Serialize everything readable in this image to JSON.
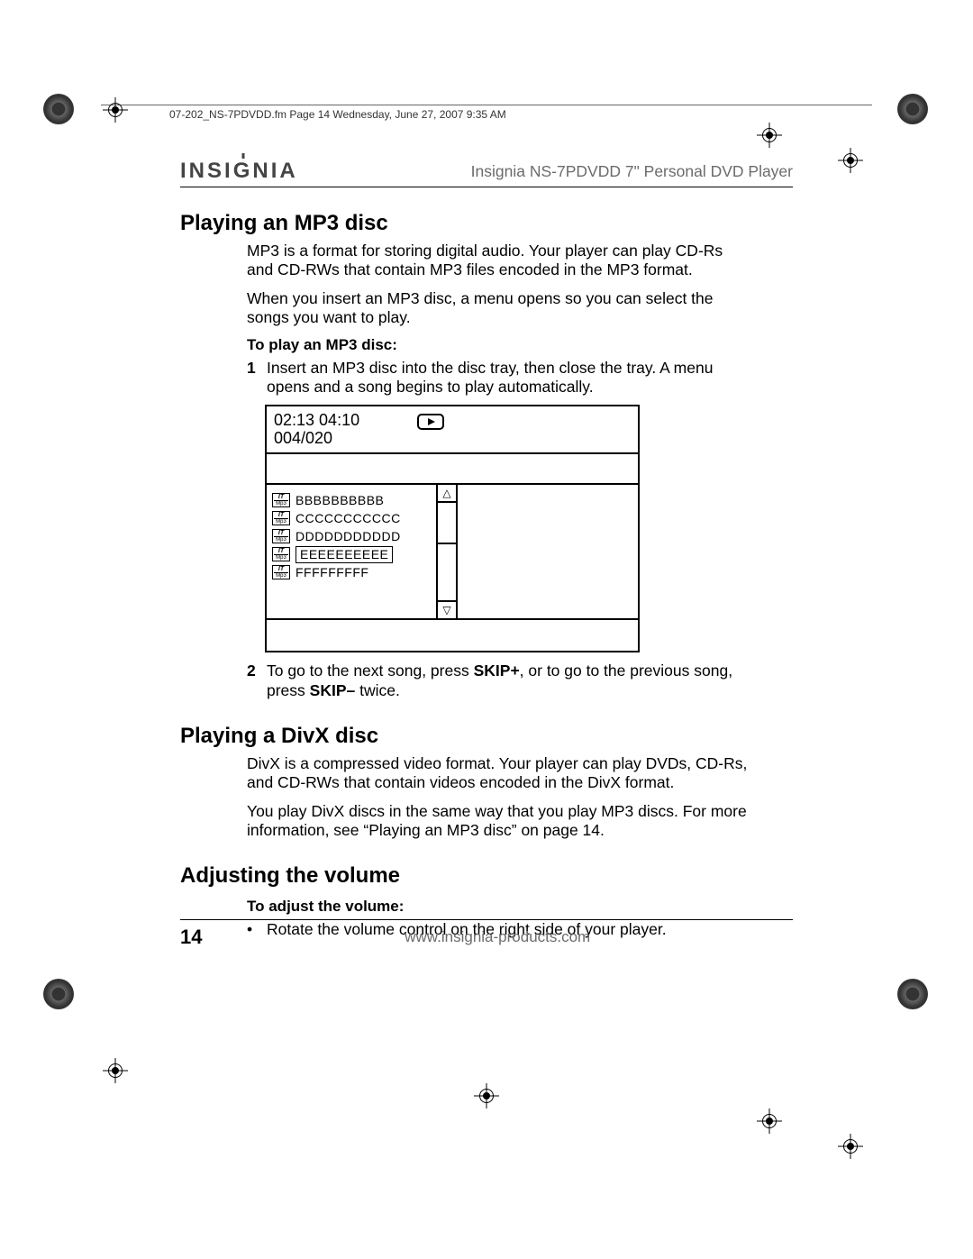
{
  "meta_header": "07-202_NS-7PDVDD.fm  Page 14  Wednesday, June 27, 2007  9:35 AM",
  "brand": "INSIGNIA",
  "product_name": "Insignia NS-7PDVDD 7\" Personal DVD Player",
  "sections": {
    "mp3": {
      "heading": "Playing an MP3 disc",
      "p1": "MP3 is a format for storing digital audio. Your player can play CD-Rs and CD-RWs that contain MP3 files encoded in the MP3 format.",
      "p2": "When you insert an MP3 disc, a menu opens so you can select the songs you want to play.",
      "sub": "To play an MP3 disc:",
      "step1_n": "1",
      "step1_t": "Insert an MP3 disc into the disc tray, then close the tray. A menu opens and a song begins to play automatically.",
      "step2_n": "2",
      "step2_t_a": "To go to the next song, press ",
      "step2_b1": "SKIP+",
      "step2_t_b": ", or to go to the previous song, press ",
      "step2_b2": "SKIP–",
      "step2_t_c": " twice."
    },
    "divx": {
      "heading": "Playing a DivX disc",
      "p1": "DivX is a compressed video format. Your player can play DVDs, CD-Rs, and CD-RWs that contain videos encoded in the DivX format.",
      "p2": "You play DivX discs in the same way that you play MP3 discs. For more information, see “Playing an MP3 disc” on page 14."
    },
    "volume": {
      "heading": "Adjusting the volume",
      "sub": "To adjust the volume:",
      "bullet": "Rotate the volume control on the right side of your player."
    }
  },
  "screen": {
    "time": "02:13 04:10",
    "track": "004/020",
    "files": [
      "BBBBBBBBBB",
      "CCCCCCCCCCC",
      "DDDDDDDDDDD",
      "EEEEEEEEEE",
      "FFFFFFFFF"
    ],
    "selected_index": 3,
    "scroll_up": "△",
    "scroll_down": "▽",
    "badge_top": "IT",
    "badge_bot": "Mp3"
  },
  "footer": {
    "page": "14",
    "url": "www.insignia-products.com"
  }
}
